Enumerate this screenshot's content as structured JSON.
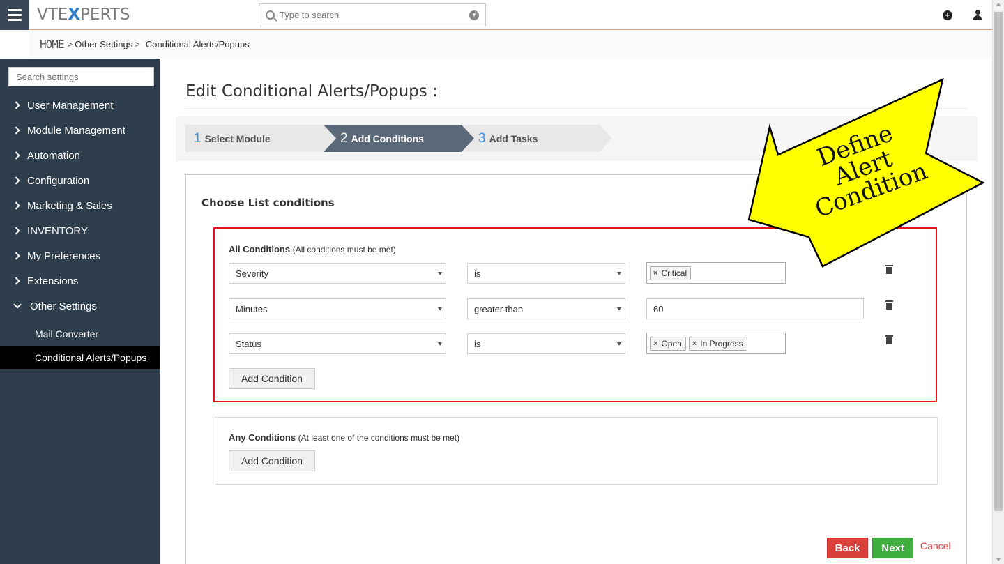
{
  "header": {
    "logo_prefix": "VTE",
    "logo_x": "X",
    "logo_suffix": "PERTS",
    "search_placeholder": "Type to search"
  },
  "breadcrumb": {
    "home": "HOME",
    "items": [
      "Other Settings",
      "Conditional Alerts/Popups"
    ]
  },
  "sidebar": {
    "search_placeholder": "Search settings",
    "items": [
      {
        "label": "User Management"
      },
      {
        "label": "Module Management"
      },
      {
        "label": "Automation"
      },
      {
        "label": "Configuration"
      },
      {
        "label": "Marketing & Sales"
      },
      {
        "label": "INVENTORY"
      },
      {
        "label": "My Preferences"
      },
      {
        "label": "Extensions"
      },
      {
        "label": "Other Settings"
      }
    ],
    "sub_items": [
      {
        "label": "Mail Converter"
      },
      {
        "label": "Conditional Alerts/Popups"
      }
    ]
  },
  "page": {
    "title": "Edit Conditional Alerts/Popups :",
    "steps": [
      {
        "num": "1",
        "label": "Select Module"
      },
      {
        "num": "2",
        "label": "Add Conditions"
      },
      {
        "num": "3",
        "label": "Add Tasks"
      }
    ],
    "section_title": "Choose List conditions"
  },
  "all_conditions": {
    "title": "All Conditions",
    "hint": "(All conditions must be met)",
    "rows": [
      {
        "field": "Severity",
        "operator": "is",
        "tags": [
          "Critical"
        ]
      },
      {
        "field": "Minutes",
        "operator": "greater than",
        "value": "60"
      },
      {
        "field": "Status",
        "operator": "is",
        "tags": [
          "Open",
          "In Progress"
        ]
      }
    ],
    "add_label": "Add Condition"
  },
  "any_conditions": {
    "title": "Any Conditions",
    "hint": "(At least one of the conditions must be met)",
    "add_label": "Add Condition"
  },
  "footer": {
    "back": "Back",
    "next": "Next",
    "cancel": "Cancel"
  },
  "callout": {
    "text_line1": "Define Alert",
    "text_line2": "Condition"
  },
  "colors": {
    "sidebar_bg": "#2f3e4c",
    "active_step": "#5a6878",
    "highlight_border": "#e2151a",
    "callout_fill": "#ffff00"
  }
}
